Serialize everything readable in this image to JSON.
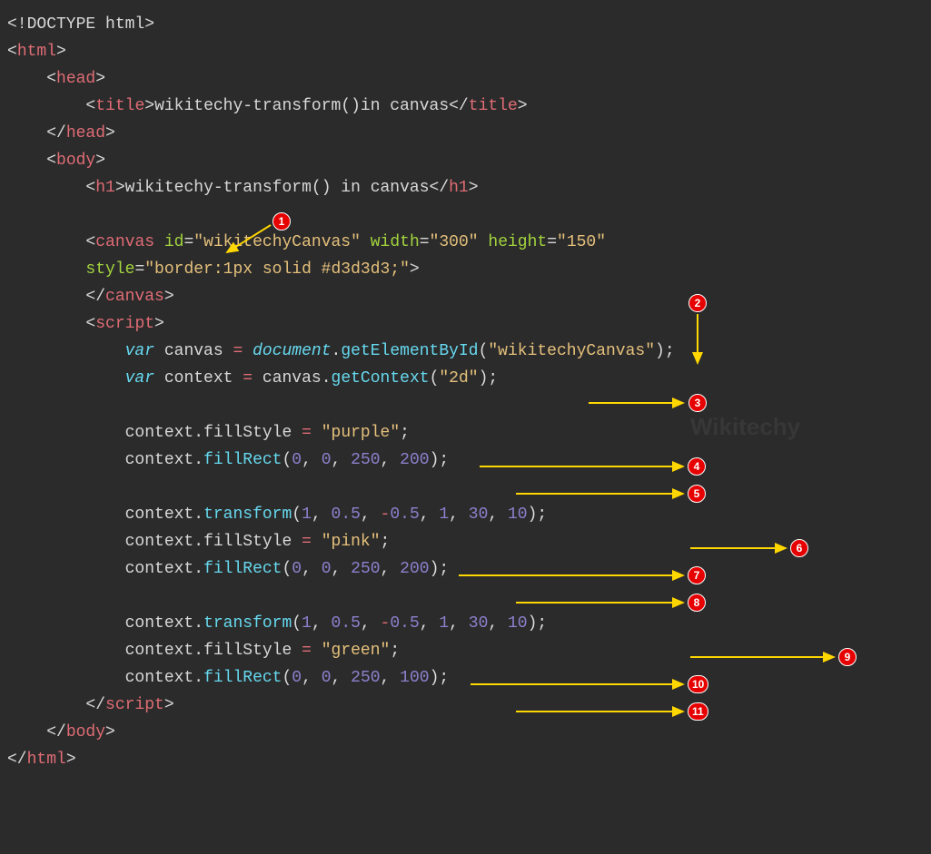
{
  "code": {
    "doctype": "<!DOCTYPE html>",
    "html_open": "html",
    "head_open": "head",
    "title_tag": "title",
    "title_text": "wikitechy-transform()in canvas",
    "head_close": "head",
    "body_open": "body",
    "h1_tag": "h1",
    "h1_text": "wikitechy-transform() in canvas",
    "canvas_tag": "canvas",
    "canvas_id_attr": "id",
    "canvas_id_val": "\"wikitechyCanvas\"",
    "canvas_width_attr": "width",
    "canvas_width_val": "\"300\"",
    "canvas_height_attr": "height",
    "canvas_height_val": "\"150\"",
    "canvas_style_attr": "style",
    "canvas_style_val": "\"border:1px solid #d3d3d3;\"",
    "script_tag": "script",
    "var_kw": "var",
    "canvas_var": "canvas",
    "document_obj": "document",
    "getElementById": "getElementById",
    "canvas_id_arg": "\"wikitechyCanvas\"",
    "context_var": "context",
    "getContext": "getContext",
    "ctx_arg": "\"2d\"",
    "fillStyle": "fillStyle",
    "fillRect": "fillRect",
    "transform": "transform",
    "purple": "\"purple\"",
    "pink": "\"pink\"",
    "green": "\"green\"",
    "n0": "0",
    "n1": "1",
    "n05": "0.5",
    "nm05": "0.5",
    "n30": "30",
    "n10": "10",
    "n250": "250",
    "n200": "200",
    "n100": "100",
    "body_close": "body",
    "html_close": "html"
  },
  "annotations": {
    "b1": "1",
    "b2": "2",
    "b3": "3",
    "b4": "4",
    "b5": "5",
    "b6": "6",
    "b7": "7",
    "b8": "8",
    "b9": "9",
    "b10": "10",
    "b11": "11"
  },
  "watermark": "Wikitechy"
}
